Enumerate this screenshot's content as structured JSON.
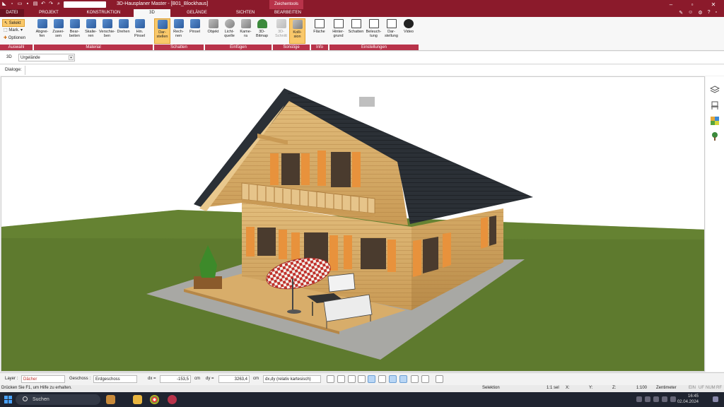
{
  "window": {
    "title": "3D-Hausplaner Master - [B01_Blockhaus]",
    "context_tab": "Zeichentools"
  },
  "menu_tabs": [
    {
      "label": "DATEI"
    },
    {
      "label": "PROJEKT"
    },
    {
      "label": "KONSTRUKTION"
    },
    {
      "label": "3D"
    },
    {
      "label": "GELÄNDE"
    },
    {
      "label": "SICHTEN"
    },
    {
      "label": "BEARBEITEN"
    }
  ],
  "ribbon": {
    "auswahl": {
      "label": "Auswahl",
      "selekt": "Selekt",
      "mark": "Mark.",
      "optionen": "Optionen"
    },
    "material": {
      "label": "Material",
      "buttons": [
        "Abgrei-\nfen",
        "Zuwei-\nsen",
        "Bear-\nbeiten",
        "Skalie-\nren",
        "Verschie-\nben",
        "Drehen",
        "Hin.\nPinsel"
      ]
    },
    "schatten": {
      "label": "Schatten",
      "buttons": [
        "Dar-\nstellen",
        "Rech-\nnen",
        "Pinsel"
      ]
    },
    "einfuegen": {
      "label": "Einfügen",
      "buttons": [
        "Objekt",
        "Licht-\nquelle",
        "Kame-\nra",
        "3D-\nBitmap"
      ]
    },
    "sonstige": {
      "label": "Sonstige",
      "buttons": [
        "3D-\nSchnitt",
        "Kolli-\nsion"
      ]
    },
    "info": {
      "label": "Info",
      "buttons": [
        "Fläche"
      ]
    },
    "einstellungen": {
      "label": "Einstellungen",
      "buttons": [
        "Hinter-\ngrund",
        "Schatten",
        "Beleuch-\ntung",
        "Dar-\nstellung",
        "Video"
      ]
    }
  },
  "viewbar": {
    "label": "3D",
    "combo_value": "Urgelände"
  },
  "dialogbar": {
    "label": "Dialoge:"
  },
  "statusbar": {
    "layer_label": "Layer :",
    "layer_value": "Dächer",
    "geschoss_label": "Geschoss :",
    "geschoss_value": "Erdgeschoss",
    "dx_label": "dx =",
    "dx_value": "-153,5",
    "dx_unit": "cm",
    "dy_label": "dy =",
    "dy_value": "3263,4",
    "dy_unit": "cm",
    "mode_value": "dx,dy (relativ kartesisch)"
  },
  "statusbar2": {
    "help": "Drücken Sie F1, um Hilfe zu erhalten.",
    "mode": "Selektion",
    "sel": "1:1 sel",
    "x": "X:",
    "y": "Y:",
    "z": "Z:",
    "scale": "1:100",
    "unit": "Zentimeter",
    "flags": [
      "EIN",
      "UF",
      "NUM",
      "RF"
    ]
  },
  "taskbar": {
    "search": "Suchen",
    "time": "16:45",
    "date": "02.04.2024"
  },
  "colors": {
    "title_bar": "#8b1a2b",
    "group_label": "#b8334a",
    "active_button": "#f9c86a",
    "grass": "#5e7a2e",
    "roof": "#2b3036",
    "wood": "#d9b06e"
  }
}
